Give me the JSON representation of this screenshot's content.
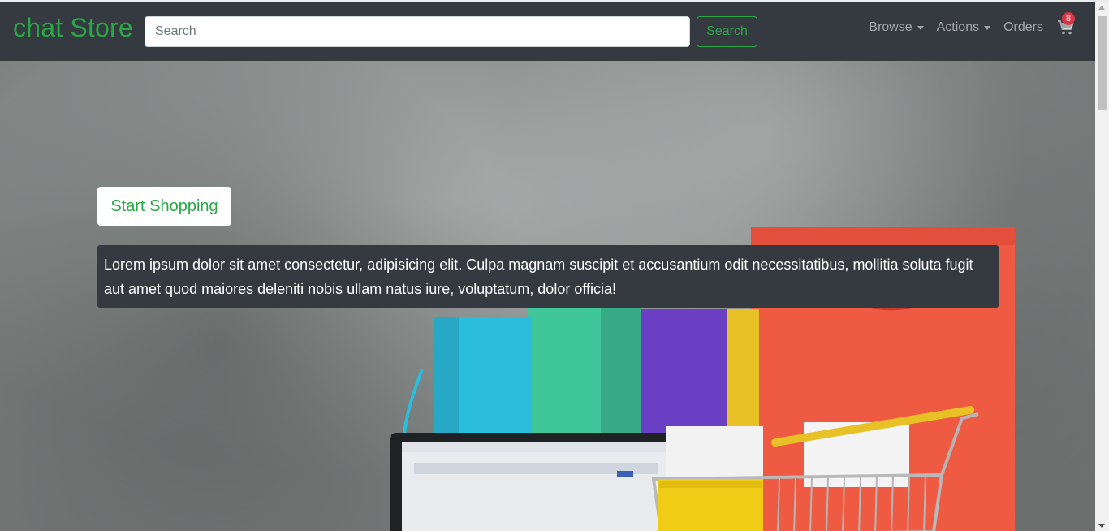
{
  "navbar": {
    "brand": "chat Store",
    "search": {
      "placeholder": "Search",
      "value": "",
      "button_label": "Search"
    },
    "links": [
      {
        "label": "Browse",
        "dropdown": true
      },
      {
        "label": "Actions",
        "dropdown": true
      },
      {
        "label": "Orders",
        "dropdown": false
      }
    ],
    "cart": {
      "icon": "shopping-cart-icon",
      "count": "8"
    }
  },
  "hero": {
    "cta_label": "Start Shopping",
    "intro_text": "Lorem ipsum dolor sit amet consectetur, adipisicing elit. Culpa magnam suscipit et accusantium odit necessitatibus, mollitia soluta fugit aut amet quod maiores deleniti nobis ullam natus iure, voluptatum, dolor officia!"
  },
  "colors": {
    "navbar_bg": "#343a40",
    "brand": "#28a745",
    "badge": "#dc3545",
    "intro_bg": "#343a40"
  }
}
